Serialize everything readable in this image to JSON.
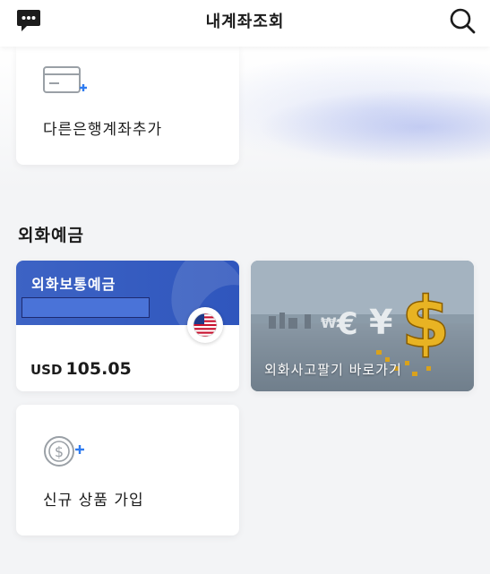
{
  "header": {
    "title": "내계좌조회",
    "left_icon": "chat-bubble-icon",
    "right_icon": "search-icon"
  },
  "add_bank_card": {
    "icon": "card-plus-icon",
    "label": "다른은행계좌추가"
  },
  "section": {
    "title": "외화예금"
  },
  "deposit_card": {
    "name": "외화보통예금",
    "currency": "USD",
    "amount": "105.05",
    "flag_icon": "us-flag-icon",
    "accent_color": "#3a60c2"
  },
  "exchange_card": {
    "label": "외화사고팔기 바로가기"
  },
  "new_product_card": {
    "icon": "coin-plus-icon",
    "label": "신규 상품 가입"
  },
  "colors": {
    "accent_blue": "#2f7bf0",
    "card_blue": "#3a60c2",
    "background": "#f3f4f6"
  }
}
